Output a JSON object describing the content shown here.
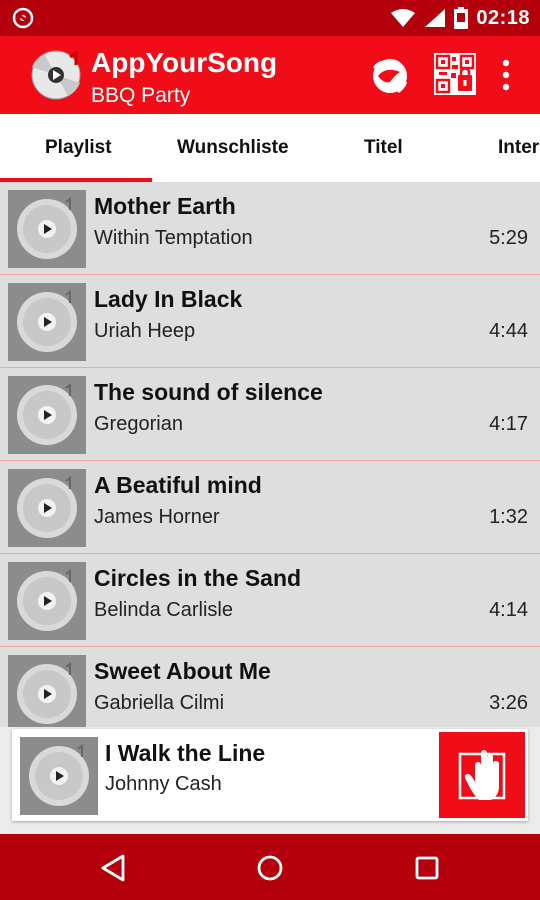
{
  "status_bar": {
    "time": "02:18",
    "icons": [
      "app-notification-icon",
      "wifi-icon",
      "signal-icon",
      "battery-icon"
    ]
  },
  "app_bar": {
    "title": "AppYourSong",
    "subtitle": "BBQ Party",
    "actions": [
      "hand-wave-icon",
      "qr-code-lock-icon",
      "overflow-menu-icon"
    ]
  },
  "tabs": [
    {
      "label": "Playlist",
      "selected": true
    },
    {
      "label": "Wunschliste",
      "selected": false
    },
    {
      "label": "Titel",
      "selected": false
    },
    {
      "label": "Interpreten",
      "selected": false
    }
  ],
  "playlist": [
    {
      "title": "Mother Earth",
      "artist": "Within Temptation",
      "duration": "5:29"
    },
    {
      "title": "Lady In Black",
      "artist": "Uriah Heep",
      "duration": "4:44"
    },
    {
      "title": "The sound of silence",
      "artist": "Gregorian",
      "duration": "4:17"
    },
    {
      "title": "A Beatiful mind",
      "artist": "James Horner",
      "duration": "1:32"
    },
    {
      "title": "Circles in the Sand",
      "artist": "Belinda Carlisle",
      "duration": "4:14"
    },
    {
      "title": "Sweet About Me",
      "artist": "Gabriella Cilmi",
      "duration": "3:26"
    }
  ],
  "now_playing": {
    "title": "I Walk the Line",
    "artist": "Johnny Cash"
  },
  "colors": {
    "primary": "#f00d18",
    "primary_dark": "#b3000c",
    "row_bg": "#dedede",
    "divider": "#f1a7a7"
  }
}
